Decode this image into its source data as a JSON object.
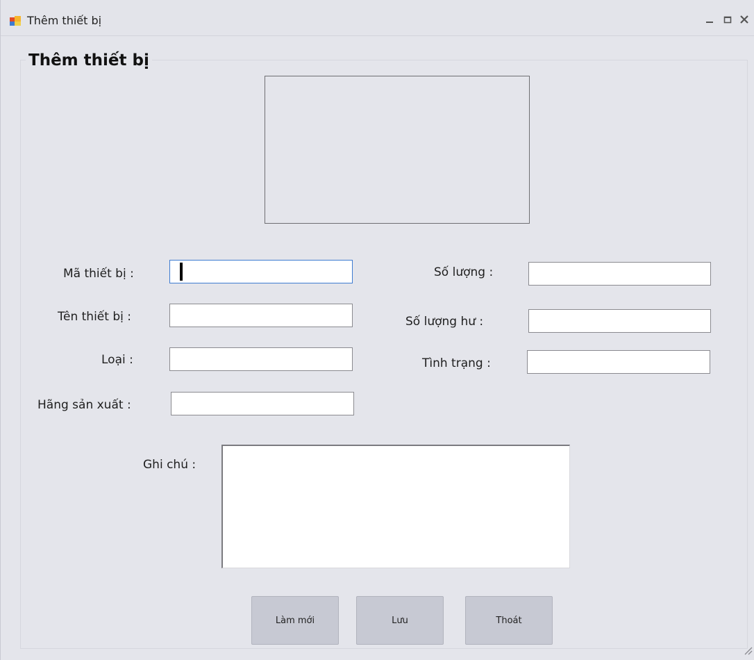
{
  "window": {
    "title": "Thêm thiết bị",
    "minimize_glyph": "–",
    "maximize_glyph": "☐",
    "close_glyph": "✕"
  },
  "form": {
    "group_title": "Thêm thiết bị",
    "fields": {
      "ma_thiet_bi": {
        "label": "Mã thiết bị :",
        "value": ""
      },
      "ten_thiet_bi": {
        "label": "Tên thiết bị :",
        "value": ""
      },
      "loai": {
        "label": "Loại :",
        "value": ""
      },
      "hang_san_xuat": {
        "label": "Hãng sản xuất :",
        "value": ""
      },
      "so_luong": {
        "label": "Số lượng :",
        "value": ""
      },
      "so_luong_hu": {
        "label": "Số lượng hư :",
        "value": ""
      },
      "tinh_trang": {
        "label": "Tình trạng :",
        "value": ""
      },
      "ghi_chu": {
        "label": "Ghi chú :",
        "value": ""
      }
    },
    "buttons": {
      "refresh": "Làm mới",
      "save": "Lưu",
      "exit": "Thoát"
    }
  },
  "icons": {
    "app": "app-window-icon",
    "minimize": "minimize-icon",
    "maximize": "maximize-icon",
    "close": "close-icon",
    "grip": "resize-grip-icon"
  },
  "colors": {
    "background": "#e4e5eb",
    "button": "#c7c9d3",
    "focus_border": "#3d7bd1"
  }
}
